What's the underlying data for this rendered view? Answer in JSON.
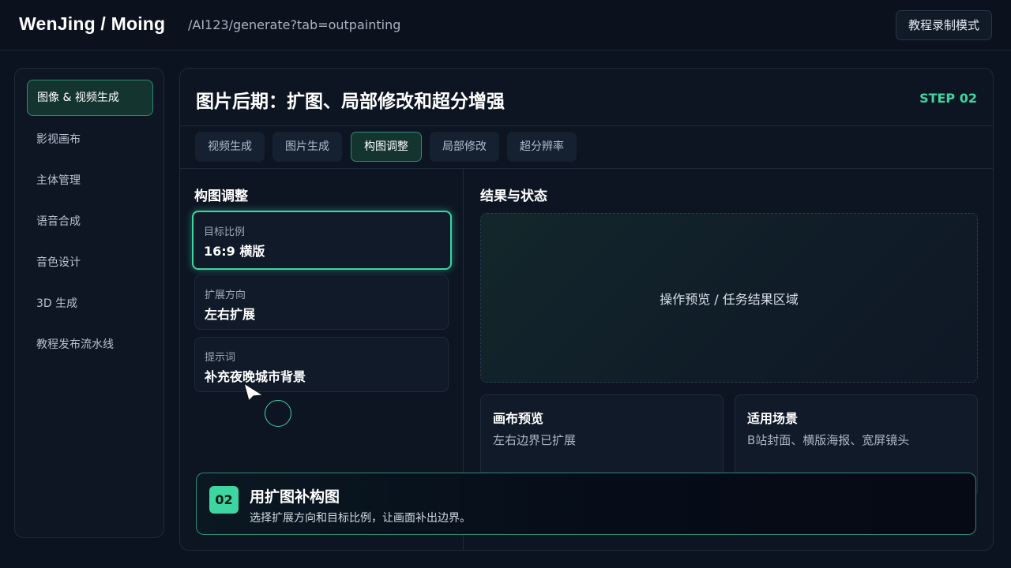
{
  "header": {
    "brand": "WenJing / Moing",
    "url": "/AI123/generate?tab=outpainting",
    "mode_button": "教程录制模式"
  },
  "sidebar": {
    "items": [
      {
        "label": "图像 & 视频生成",
        "active": true
      },
      {
        "label": "影视画布"
      },
      {
        "label": "主体管理"
      },
      {
        "label": "语音合成"
      },
      {
        "label": "音色设计"
      },
      {
        "label": "3D 生成"
      },
      {
        "label": "教程发布流水线"
      }
    ]
  },
  "panel": {
    "title": "图片后期：扩图、局部修改和超分增强",
    "step": "STEP 02",
    "tabs": [
      {
        "label": "视频生成"
      },
      {
        "label": "图片生成"
      },
      {
        "label": "构图调整",
        "active": true
      },
      {
        "label": "局部修改"
      },
      {
        "label": "超分辨率"
      }
    ]
  },
  "composition": {
    "title": "构图调整",
    "fields": [
      {
        "label": "目标比例",
        "value": "16:9 横版"
      },
      {
        "label": "扩展方向",
        "value": "左右扩展"
      },
      {
        "label": "提示词",
        "value": "补充夜晚城市背景"
      }
    ]
  },
  "results": {
    "title": "结果与状态",
    "preview_text": "操作预览 / 任务结果区域",
    "cards": [
      {
        "title": "画布预览",
        "text": "左右边界已扩展"
      },
      {
        "title": "适用场景",
        "text": "B站封面、横版海报、宽屏镜头"
      }
    ]
  },
  "banner": {
    "badge": "02",
    "title": "用扩图补构图",
    "description": "选择扩展方向和目标比例，让画面补出边界。"
  },
  "colors": {
    "accent": "#3dd6a0",
    "background": "#0c1320"
  }
}
